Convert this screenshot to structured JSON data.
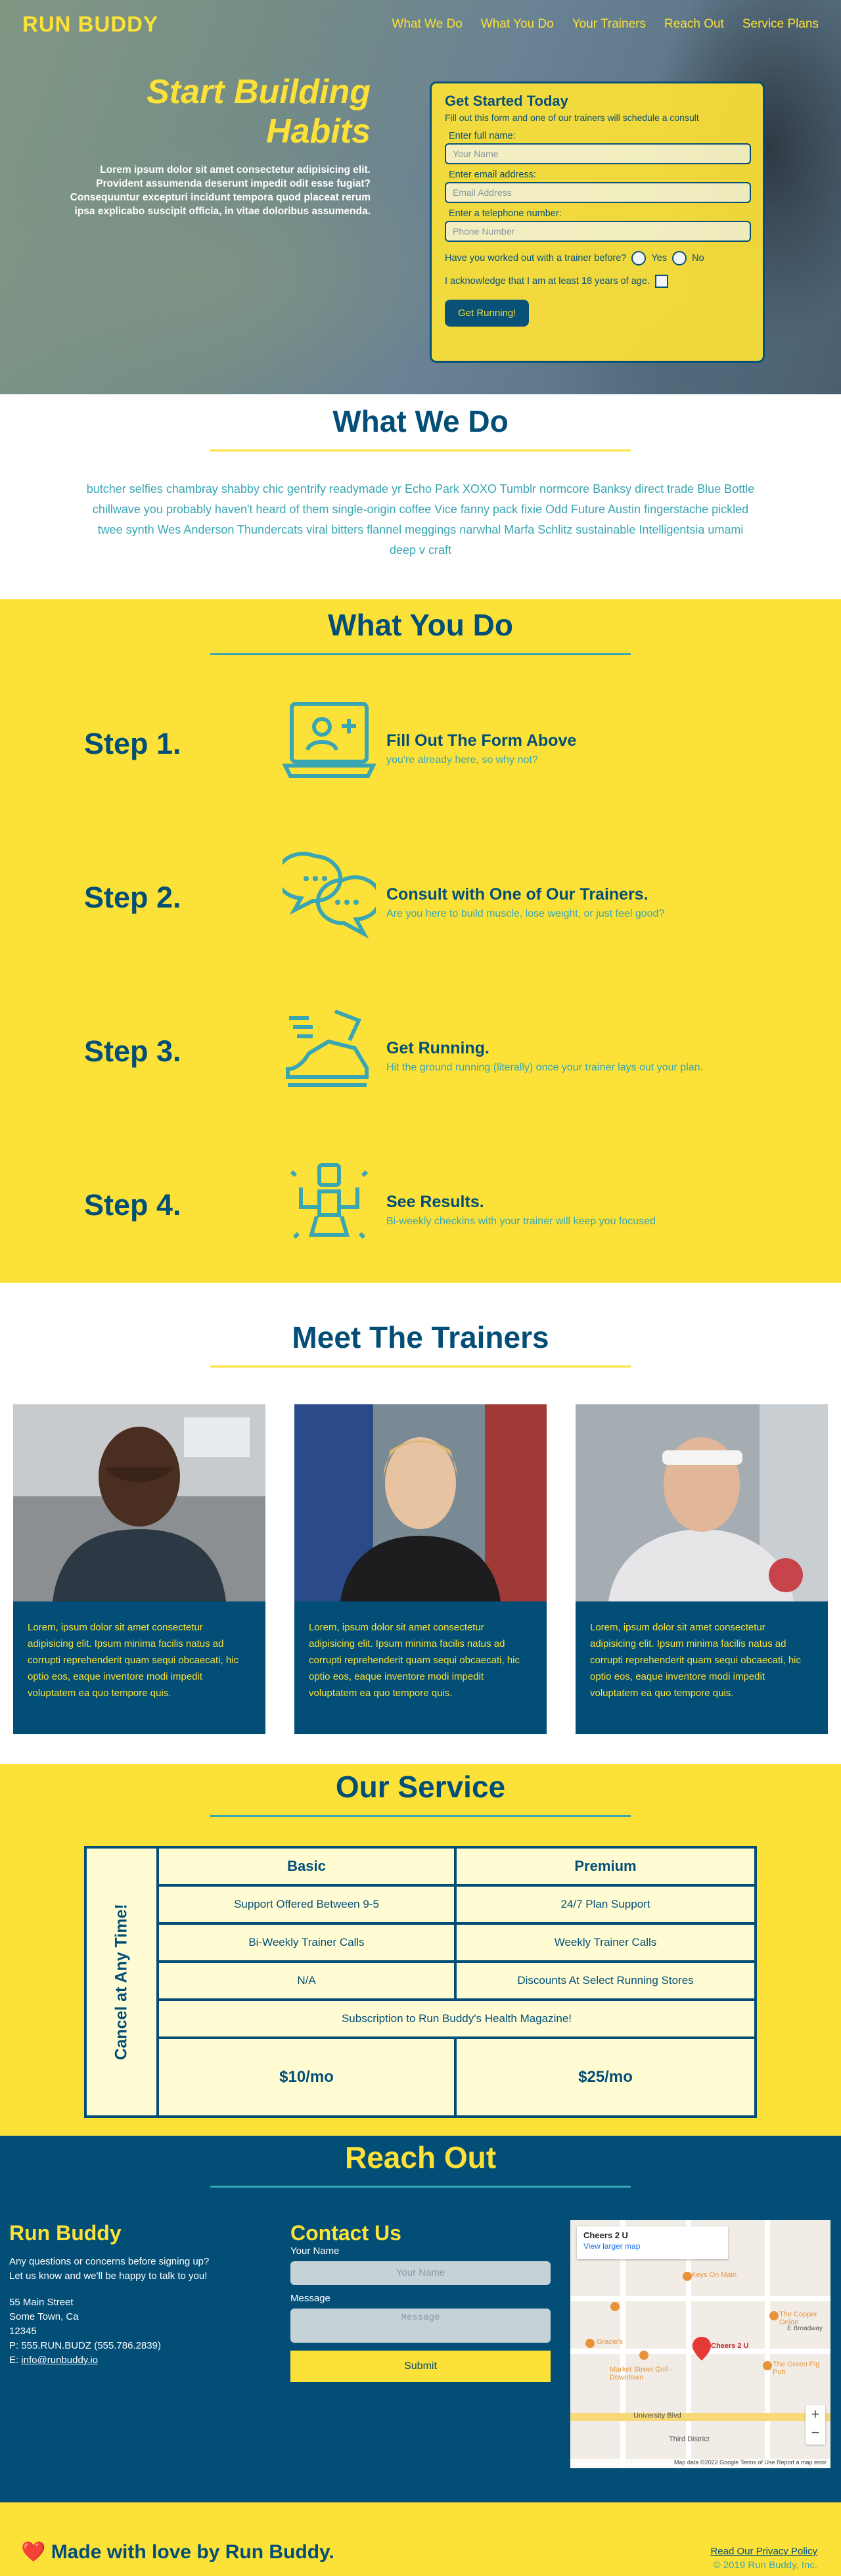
{
  "nav": {
    "logo": "RUN BUDDY",
    "links": [
      "What We Do",
      "What You Do",
      "Your Trainers",
      "Reach Out",
      "Service Plans"
    ]
  },
  "hero": {
    "title": "Start Building Habits",
    "text": "Lorem ipsum dolor sit amet consectetur adipisicing elit. Provident assumenda deserunt impedit odit esse fugiat? Consequuntur excepturi incidunt tempora quod placeat rerum ipsa explicabo suscipit officia, in vitae doloribus assumenda."
  },
  "form": {
    "title": "Get Started Today",
    "subtitle": "Fill out this form and one of our trainers will schedule a consult",
    "name_label": "Enter full name:",
    "name_placeholder": "Your Name",
    "email_label": "Enter email address:",
    "email_placeholder": "Email Address",
    "phone_label": "Enter a telephone number:",
    "phone_placeholder": "Phone Number",
    "question": "Have you worked out with a trainer before?",
    "yes": "Yes",
    "no": "No",
    "ack": "I acknowledge that I am at least 18 years of age.",
    "button": "Get Running!"
  },
  "what_we_do": {
    "title": "What We Do",
    "text": "butcher selfies chambray shabby chic gentrify readymade yr Echo Park XOXO Tumblr normcore Banksy direct trade Blue Bottle chillwave you probably haven't heard of them single-origin coffee Vice fanny pack fixie Odd Future Austin fingerstache pickled twee synth Wes Anderson Thundercats viral bitters flannel meggings narwhal Marfa Schlitz sustainable Intelligentsia umami deep v craft"
  },
  "what_you_do": {
    "title": "What You Do",
    "steps": [
      {
        "num": "Step 1.",
        "title": "Fill Out The Form Above",
        "text": "you're already here, so why not?",
        "icon": "laptop-user-icon"
      },
      {
        "num": "Step 2.",
        "title": "Consult with One of Our Trainers.",
        "text": "Are you here to build muscle, lose weight, or just feel good?",
        "icon": "chat-bubbles-icon"
      },
      {
        "num": "Step 3.",
        "title": "Get Running.",
        "text": "Hit the ground running (literally) once your trainer lays out your plan.",
        "icon": "running-shoe-icon"
      },
      {
        "num": "Step 4.",
        "title": "See Results.",
        "text": "Bi-weekly checkins with your trainer will keep you focused",
        "icon": "strong-person-icon"
      }
    ]
  },
  "trainers": {
    "title": "Meet The Trainers",
    "cards": [
      {
        "text": "Lorem, ipsum dolor sit amet consectetur adipisicing elit. Ipsum minima facilis natus ad corrupti reprehenderit quam sequi obcaecati, hic optio eos, eaque inventore modi impedit voluptatem ea quo tempore quis."
      },
      {
        "text": "Lorem, ipsum dolor sit amet consectetur adipisicing elit. Ipsum minima facilis natus ad corrupti reprehenderit quam sequi obcaecati, hic optio eos, eaque inventore modi impedit voluptatem ea quo tempore quis."
      },
      {
        "text": "Lorem, ipsum dolor sit amet consectetur adipisicing elit. Ipsum minima facilis natus ad corrupti reprehenderit quam sequi obcaecati, hic optio eos, eaque inventore modi impedit voluptatem ea quo tempore quis."
      }
    ]
  },
  "service": {
    "title": "Our Service",
    "cancel": "Cancel at Any Time!",
    "basic": "Basic",
    "premium": "Premium",
    "rows": [
      [
        "Support Offered Between 9-5",
        "24/7 Plan Support"
      ],
      [
        "Bi-Weekly Trainer Calls",
        "Weekly Trainer Calls"
      ],
      [
        "N/A",
        "Discounts At Select Running Stores"
      ]
    ],
    "magazine": "Subscription to Run Buddy's Health Magazine!",
    "basic_price": "$10/mo",
    "premium_price": "$25/mo"
  },
  "reach": {
    "title": "Reach Out",
    "company": "Run Buddy",
    "blurb1": "Any questions or concerns before signing up?",
    "blurb2": "Let us know and we'll be happy to talk to you!",
    "street": "55 Main Street",
    "city": "Some Town, Ca",
    "zip": "12345",
    "phone": "P: 555.RUN.BUDZ (555.786.2839)",
    "email_prefix": "E: ",
    "email": "info@runbuddy.io",
    "contact_title": "Contact Us",
    "name_label": "Your Name",
    "name_placeholder": "Your Name",
    "message_label": "Message",
    "message_placeholder": "Message",
    "submit": "Submit"
  },
  "map": {
    "place": "Cheers 2 U",
    "larger": "View larger map",
    "labels": [
      "Keys On Main",
      "Cheers 2 U",
      "The Copper Onion",
      "Gracie's",
      "Market Street Grill - Downtown",
      "The Green Pig Pub",
      "University Blvd",
      "Third District",
      "E Broadway"
    ],
    "footer": "Map data ©2022 Google   Terms of Use   Report a map error"
  },
  "footer": {
    "love": "❤️ Made with love by Run Buddy.",
    "privacy": "Read Our Privacy Policy",
    "copyright": "© 2019 Run Buddy, Inc."
  }
}
